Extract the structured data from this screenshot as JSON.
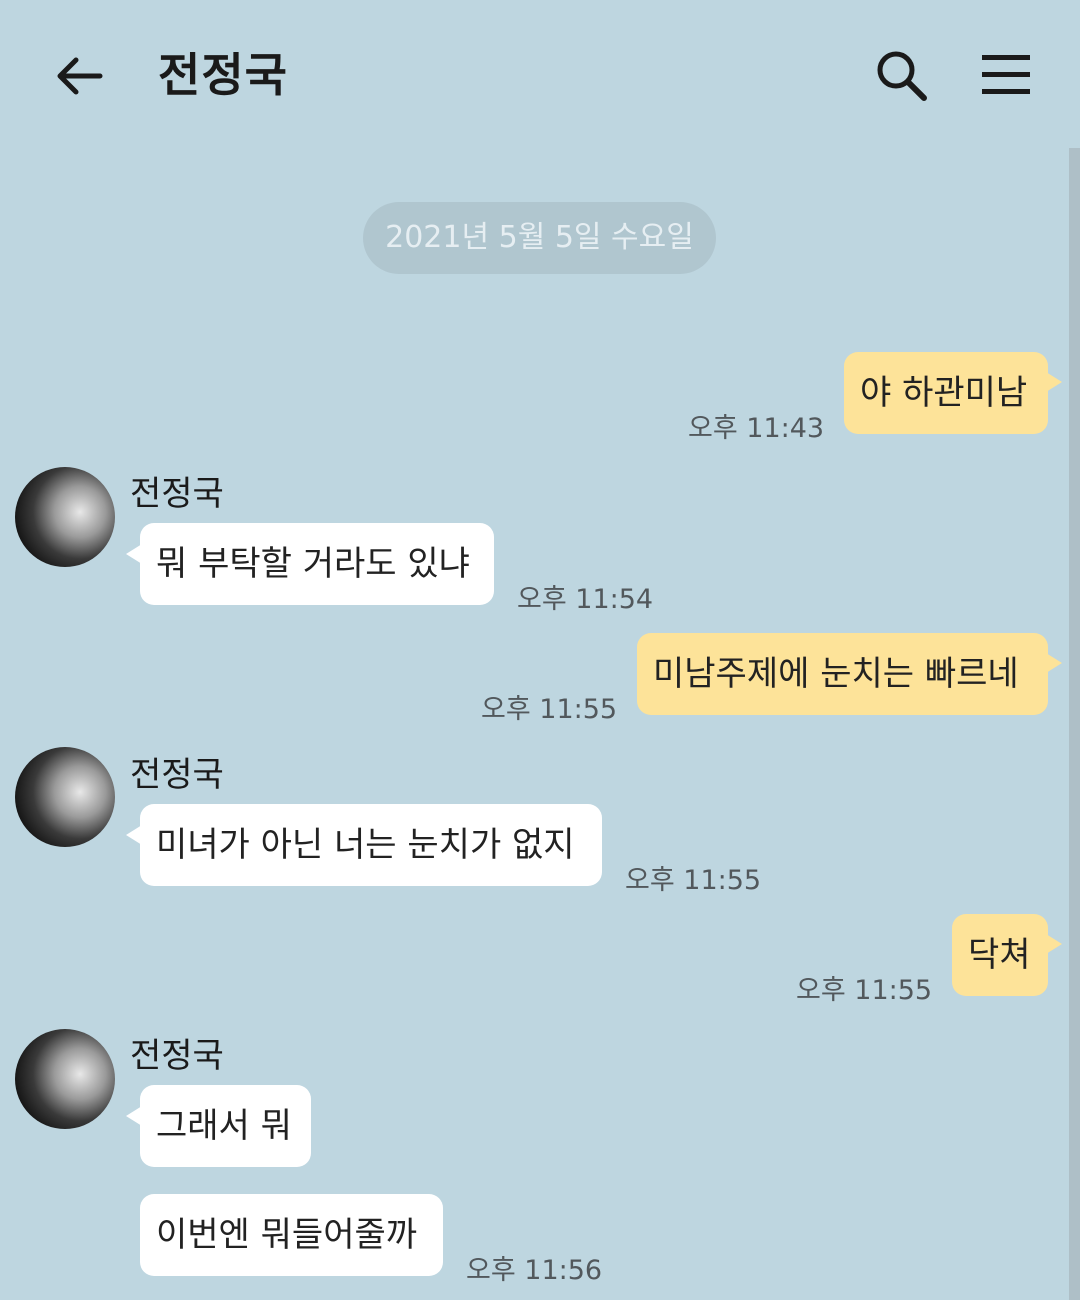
{
  "header": {
    "title": "전정국",
    "back_icon": "arrow-left-icon",
    "search_icon": "search-icon",
    "menu_icon": "hamburger-menu-icon"
  },
  "date_divider": "2021년 5월 5일 수요일",
  "messages": [
    {
      "from": "me",
      "text": "야 하관미남",
      "time": "오후 11:43"
    },
    {
      "from": "other",
      "sender": "전정국",
      "text": "뭐 부탁할 거라도 있냐",
      "time": "오후 11:54"
    },
    {
      "from": "me",
      "text": "미남주제에 눈치는 빠르네",
      "time": "오후 11:55"
    },
    {
      "from": "other",
      "sender": "전정국",
      "text": "미녀가 아닌 너는 눈치가 없지",
      "time": "오후 11:55"
    },
    {
      "from": "me",
      "text": "닥쳐",
      "time": "오후 11:55"
    },
    {
      "from": "other",
      "sender": "전정국",
      "text": "그래서 뭐",
      "time": ""
    },
    {
      "from": "other",
      "text": "이번엔 뭐들어줄까",
      "time": "오후 11:56"
    }
  ],
  "colors": {
    "background": "#bed6e0",
    "my_bubble": "#fde399",
    "other_bubble": "#ffffff"
  }
}
